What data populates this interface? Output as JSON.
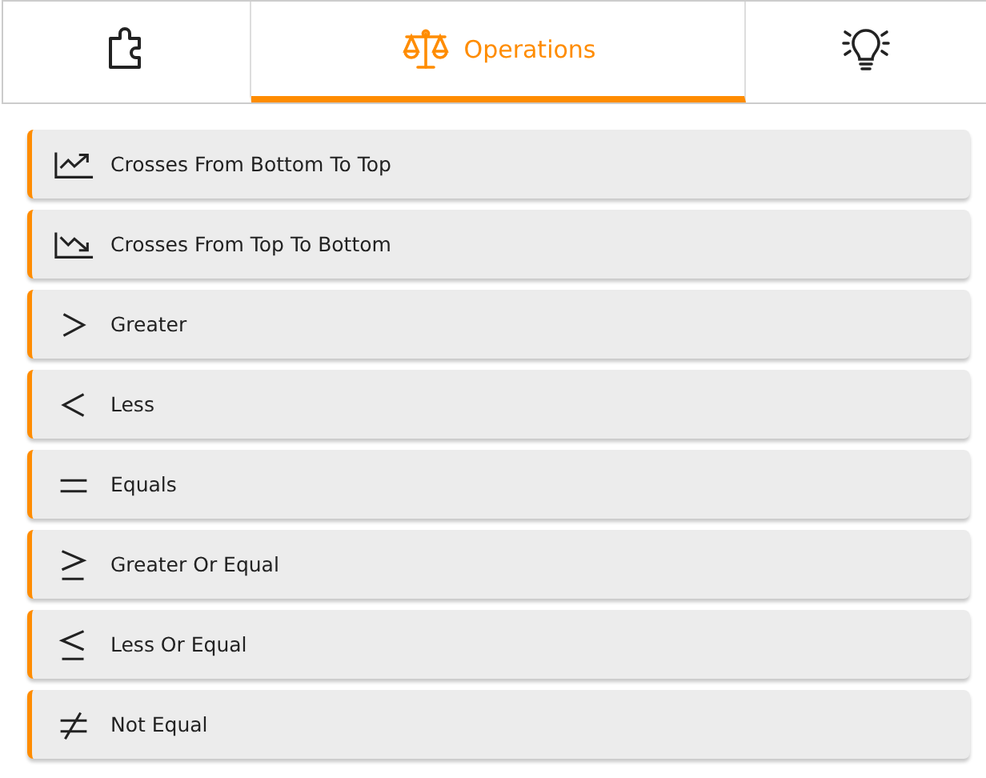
{
  "tabs": [
    {
      "kind": "puzzle",
      "selected": false
    },
    {
      "kind": "scales",
      "label": "Operations",
      "selected": true
    },
    {
      "kind": "bulb",
      "selected": false
    }
  ],
  "operations": [
    {
      "kind": "cross-up",
      "label": "Crosses From Bottom To Top"
    },
    {
      "kind": "cross-down",
      "label": "Crosses From Top To Bottom"
    },
    {
      "kind": "greater",
      "label": "Greater"
    },
    {
      "kind": "less",
      "label": "Less"
    },
    {
      "kind": "equals",
      "label": "Equals"
    },
    {
      "kind": "greater-equal",
      "label": "Greater Or Equal"
    },
    {
      "kind": "less-equal",
      "label": "Less Or Equal"
    },
    {
      "kind": "not-equal",
      "label": "Not Equal"
    }
  ]
}
